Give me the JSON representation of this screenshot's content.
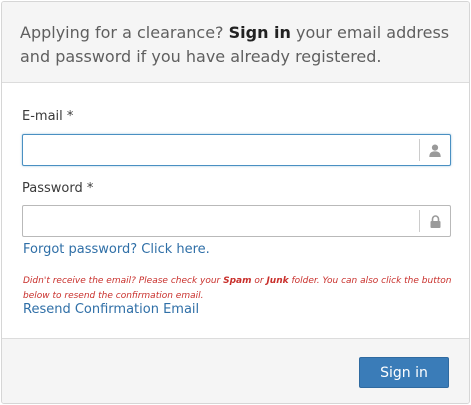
{
  "header": {
    "text_before": "Applying for a clearance? ",
    "text_strong": "Sign in",
    "text_after": " your email address and password if you have already registered."
  },
  "email": {
    "label": "E-mail *",
    "value": "",
    "placeholder": "",
    "icon": "user-icon"
  },
  "password": {
    "label": "Password *",
    "value": "",
    "placeholder": "",
    "icon": "lock-icon"
  },
  "forgot_link": "Forgot password? Click here.",
  "notice": {
    "part1": "Didn't receive the email? Please check your ",
    "spam": "Spam",
    "or": " or ",
    "junk": "Junk",
    "part2": " folder. You can also click the button below to resend the confirmation email."
  },
  "resend_link": "Resend Confirmation Email",
  "footer": {
    "sign_in_label": "Sign in"
  },
  "colors": {
    "accent": "#3a7cb8",
    "link": "#2f6fa7",
    "warning": "#c9302c",
    "focus_border": "#4a90c2"
  }
}
